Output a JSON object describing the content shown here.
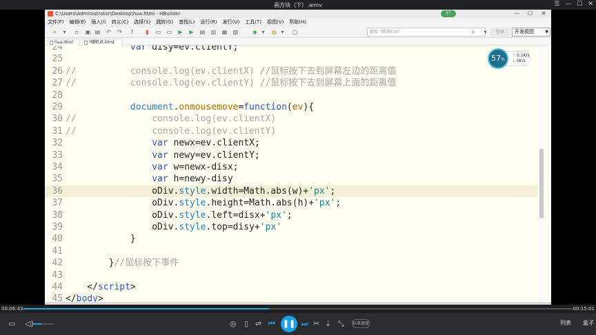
{
  "player": {
    "title": "画方块（下）.wmv",
    "time_current": "00:06:43",
    "time_total": "00:15:01",
    "progress_fraction": 0.447,
    "volume_fraction": 0.4,
    "speed_label": "标准速度",
    "playlist_label": "列表",
    "box_label": "盒子",
    "accent_color": "#1ea0e6"
  },
  "hbuilder": {
    "window_title": "C:\\Users\\Administrator\\Desktop\\hua.html - HBuilder",
    "badge": "57",
    "menu": [
      "文件(F)",
      "编辑(E)",
      "插入(I)",
      "转义(C)",
      "选择(S)",
      "跳转(G)",
      "查找(L)",
      "运行(R)",
      "发行(U)",
      "工具(T)",
      "视图(V)",
      "帮助(H)"
    ],
    "search_placeholder": "搜索（双击Ctrl）",
    "login_label": "登录",
    "view_label": "开发视图",
    "tabs": [
      {
        "label": "hua.html"
      },
      {
        "label": "*随机点.html"
      }
    ],
    "speed_badge": {
      "percent": "57",
      "up": "0.2K/s",
      "down": "0K/s"
    }
  },
  "code_lines": [
    {
      "n": "24",
      "c": "",
      "toks": [
        [
          "t-kw",
          "            var "
        ],
        [
          "t-plain",
          "disy=ev.clientY;"
        ]
      ]
    },
    {
      "n": "25",
      "c": "",
      "toks": []
    },
    {
      "n": "26",
      "c": "//",
      "toks": [
        [
          "t-com",
          "            console.log(ev.clientX) //鼠标按下去到屏幕左边的距离值"
        ]
      ]
    },
    {
      "n": "27",
      "c": "//",
      "toks": [
        [
          "t-com",
          "            console.log(ev.clientY) //鼠标按下去到屏幕上面的距离值"
        ]
      ]
    },
    {
      "n": "28",
      "c": "",
      "toks": []
    },
    {
      "n": "29",
      "c": "",
      "toks": [
        [
          "t-plain",
          "            "
        ],
        [
          "t-prop",
          "document"
        ],
        [
          "t-plain",
          "."
        ],
        [
          "t-fn",
          "onmousemove"
        ],
        [
          "t-plain",
          "="
        ],
        [
          "t-kw",
          "function"
        ],
        [
          "t-plain",
          "("
        ],
        [
          "t-fn",
          "ev"
        ],
        [
          "t-plain",
          "){"
        ]
      ]
    },
    {
      "n": "30",
      "c": "//",
      "toks": [
        [
          "t-com",
          "                console.log(ev.clientX)"
        ]
      ]
    },
    {
      "n": "31",
      "c": "//",
      "toks": [
        [
          "t-com",
          "                console.log(ev.clientY)"
        ]
      ]
    },
    {
      "n": "32",
      "c": "",
      "toks": [
        [
          "t-kw",
          "                var "
        ],
        [
          "t-plain",
          "newx=ev.clientX;"
        ]
      ]
    },
    {
      "n": "33",
      "c": "",
      "toks": [
        [
          "t-kw",
          "                var "
        ],
        [
          "t-plain",
          "newy=ev.clientY;"
        ]
      ]
    },
    {
      "n": "34",
      "c": "",
      "toks": [
        [
          "t-kw",
          "                var "
        ],
        [
          "t-plain",
          "w=newx-disx;"
        ]
      ]
    },
    {
      "n": "35",
      "c": "",
      "toks": [
        [
          "t-kw",
          "                var "
        ],
        [
          "t-plain",
          "h=newy-disy"
        ]
      ]
    },
    {
      "n": "36",
      "c": "",
      "toks": [
        [
          "t-plain",
          "                oDiv."
        ],
        [
          "t-prop",
          "style"
        ],
        [
          "t-plain",
          ".width=Math.abs(w)+"
        ],
        [
          "t-str",
          "'px'"
        ],
        [
          "t-plain",
          ";"
        ]
      ]
    },
    {
      "n": "37",
      "c": "",
      "toks": [
        [
          "t-plain",
          "                oDiv."
        ],
        [
          "t-prop",
          "style"
        ],
        [
          "t-plain",
          ".height=Math.abs(h)+"
        ],
        [
          "t-str",
          "'px'"
        ],
        [
          "t-plain",
          ";"
        ]
      ]
    },
    {
      "n": "38",
      "c": "",
      "toks": [
        [
          "t-plain",
          "                oDiv."
        ],
        [
          "t-prop",
          "style"
        ],
        [
          "t-plain",
          ".left=disx+"
        ],
        [
          "t-str",
          "'px'"
        ],
        [
          "t-plain",
          ";"
        ]
      ]
    },
    {
      "n": "39",
      "c": "",
      "toks": [
        [
          "t-plain",
          "                oDiv."
        ],
        [
          "t-prop",
          "style"
        ],
        [
          "t-plain",
          ".top=disy+"
        ],
        [
          "t-str",
          "'px'"
        ]
      ]
    },
    {
      "n": "40",
      "c": "",
      "toks": [
        [
          "t-plain",
          "            }"
        ]
      ]
    },
    {
      "n": "41",
      "c": "",
      "toks": []
    },
    {
      "n": "42",
      "c": "",
      "toks": [
        [
          "t-plain",
          "        }"
        ],
        [
          "t-com",
          "//鼠标按下事件"
        ]
      ]
    },
    {
      "n": "43",
      "c": "",
      "toks": []
    },
    {
      "n": "44",
      "c": "",
      "toks": [
        [
          "t-plain",
          "    </"
        ],
        [
          "t-tag",
          "script"
        ],
        [
          "t-plain",
          ">"
        ]
      ]
    },
    {
      "n": "45",
      "c": "",
      "toks": [
        [
          "t-plain",
          "</"
        ],
        [
          "t-tag",
          "body"
        ],
        [
          "t-plain",
          ">"
        ]
      ]
    }
  ],
  "current_line": "36"
}
